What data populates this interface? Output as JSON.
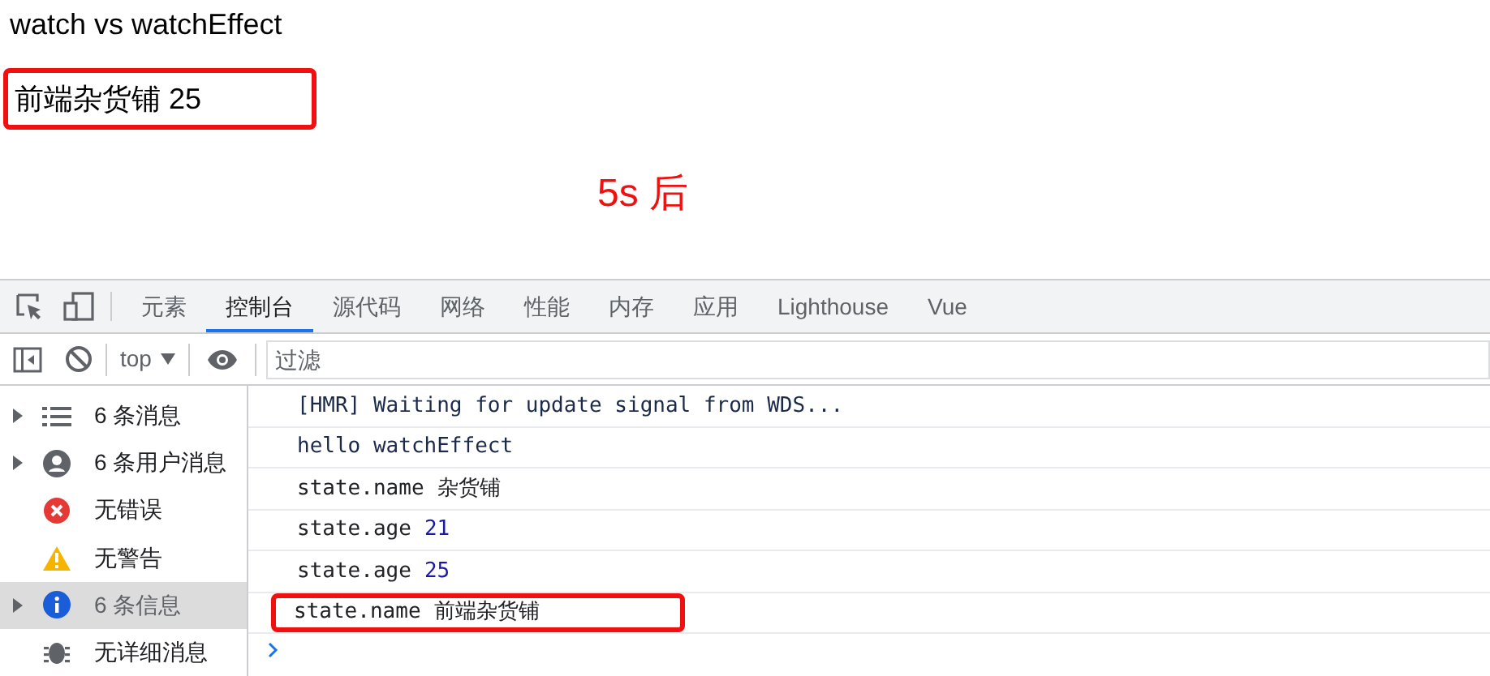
{
  "page": {
    "title": "watch vs watchEffect",
    "output": {
      "text": "前端杂货铺 25",
      "highlighted": true
    },
    "note": "5s 后"
  },
  "devtools": {
    "tabs": [
      {
        "label": "元素",
        "selected": false
      },
      {
        "label": "控制台",
        "selected": true
      },
      {
        "label": "源代码",
        "selected": false
      },
      {
        "label": "网络",
        "selected": false
      },
      {
        "label": "性能",
        "selected": false
      },
      {
        "label": "内存",
        "selected": false
      },
      {
        "label": "应用",
        "selected": false
      },
      {
        "label": "Lighthouse",
        "selected": false
      },
      {
        "label": "Vue",
        "selected": false
      }
    ],
    "toolbar": {
      "context": "top",
      "filter": {
        "placeholder": "过滤"
      }
    },
    "sidebar": [
      {
        "kind": "list",
        "label": "6 条消息",
        "expandable": true,
        "selected": false
      },
      {
        "kind": "user",
        "label": "6 条用户消息",
        "expandable": true,
        "selected": false
      },
      {
        "kind": "error",
        "label": "无错误",
        "expandable": false,
        "selected": false
      },
      {
        "kind": "warning",
        "label": "无警告",
        "expandable": false,
        "selected": false
      },
      {
        "kind": "info",
        "label": "6 条信息",
        "expandable": true,
        "selected": true
      },
      {
        "kind": "verbose",
        "label": "无详细消息",
        "expandable": false,
        "selected": false
      }
    ],
    "logs": [
      {
        "text": "[HMR] Waiting for update signal from WDS...",
        "kind": "plain",
        "highlighted": false
      },
      {
        "text": "hello watchEffect",
        "kind": "plain",
        "highlighted": false
      },
      {
        "text": "state.name",
        "value": "杂货铺",
        "kind": "string",
        "highlighted": false
      },
      {
        "text": "state.age",
        "value": "21",
        "kind": "number",
        "highlighted": false
      },
      {
        "text": "state.age",
        "value": "25",
        "kind": "number",
        "highlighted": false
      },
      {
        "text": "state.name",
        "value": "前端杂货铺",
        "kind": "string",
        "highlighted": true
      }
    ]
  }
}
